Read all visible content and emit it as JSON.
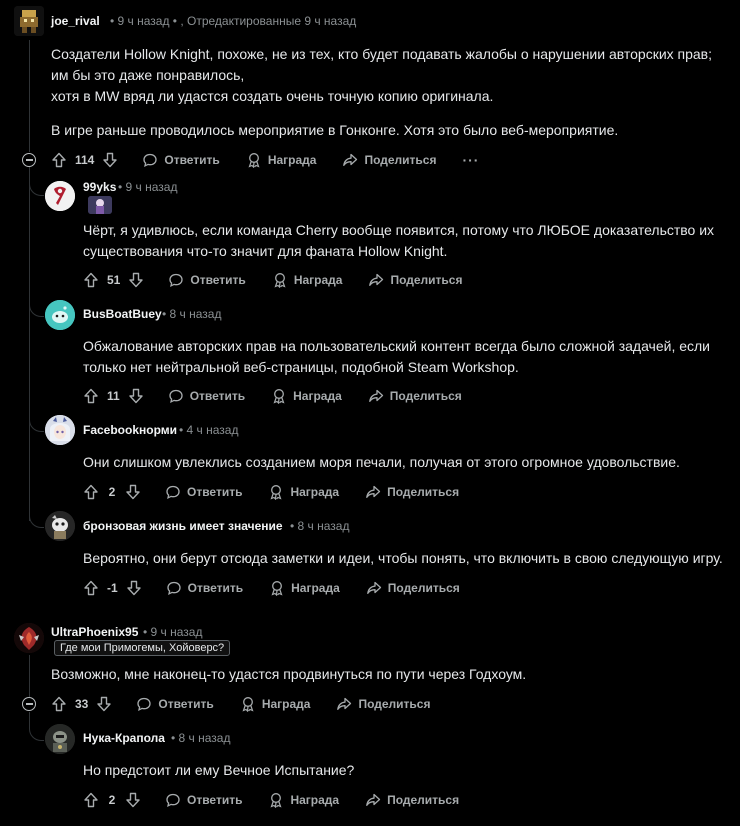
{
  "comments": [
    {
      "user": "joe_rival",
      "meta": "• 9 ч назад • , Отредактированные 9 ч назад",
      "lines": [
        "Создатели Hollow Knight, похоже, не из тех, кто будет подавать жалобы о нарушении авторских прав;",
        "им бы это даже понравилось,",
        "хотя в MW вряд ли удастся создать очень точную копию оригинала.",
        "",
        "В игре раньше проводилось мероприятие в Гонконге. Хотя это было веб-мероприятие."
      ],
      "votes": "114"
    },
    {
      "user": "99yks",
      "meta": "• 9 ч назад",
      "lines": [
        "Чёрт, я удивлюсь, если команда Cherry вообще появится, потому что ЛЮБОЕ доказательство их",
        "существования что-то значит для фаната Hollow Knight."
      ],
      "votes": "51"
    },
    {
      "user": "BusBoatBuey",
      "meta": "• 8 ч назад",
      "lines": [
        "Обжалование авторских прав на пользовательский контент всегда было сложной задачей, если",
        "только нет нейтральной веб-страницы, подобной Steam Workshop."
      ],
      "votes": "11"
    },
    {
      "user": "Facebookнорми",
      "meta": "• 4 ч назад",
      "lines": [
        "Они слишком увлеклись созданием моря печали, получая от этого огромное удовольствие."
      ],
      "votes": "2"
    },
    {
      "user": "бронзовая жизнь имеет значение",
      "meta": "• 8 ч назад",
      "lines": [
        "Вероятно, они берут отсюда заметки и идеи, чтобы понять, что включить в свою следующую игру."
      ],
      "votes": "-1"
    },
    {
      "user": "UltraPhoenix95",
      "meta": "• 9 ч назад",
      "flair": "Где мои Примогемы, Хойоверс?",
      "lines": [
        "Возможно, мне наконец-то удастся продвинуться по пути через Годхоум."
      ],
      "votes": "33"
    },
    {
      "user": "Нука-Крапола",
      "meta": "• 8 ч назад",
      "lines": [
        "Но предстоит ли ему Вечное Испытание?"
      ],
      "votes": "2"
    }
  ],
  "actions": {
    "reply": "Ответить",
    "award": "Награда",
    "share": "Поделиться",
    "more": "···"
  }
}
